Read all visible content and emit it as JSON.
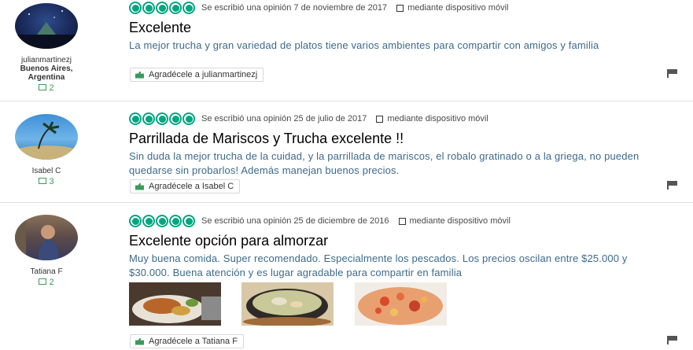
{
  "reviews": [
    {
      "username": "julianmartinezj",
      "location": "Buenos Aires, Argentina",
      "review_count": "2",
      "review_count_icon": "review-count-icon",
      "bubbles": 5,
      "date_text": "Se escribió una opinión 7 de noviembre de 2017",
      "mobile_text": "mediante dispositivo móvil",
      "title": "Excelente",
      "text": "La mejor trucha y gran variedad de platos tiene varios ambientes para compartir con amigos y familia",
      "thank_label": "Agradécele a julianmartinezj"
    },
    {
      "username": "Isabel C",
      "location": "",
      "review_count": "3",
      "review_count_icon": "review-count-icon",
      "bubbles": 5,
      "date_text": "Se escribió una opinión 25 de julio de 2017",
      "mobile_text": "mediante dispositivo móvil",
      "title": "Parrillada de Mariscos y Trucha excelente !!",
      "text": "Sin duda la mejor trucha de la cuidad, y la parrillada de mariscos, el robalo gratinado o a la griega, no pueden quedarse sin probarlos! Además manejan buenos precios.",
      "thank_label": "Agradécele a Isabel C"
    },
    {
      "username": "Tatiana F",
      "location": "",
      "review_count": "2",
      "review_count_icon": "review-count-icon",
      "bubbles": 5,
      "date_text": "Se escribió una opinión 25 de diciembre de 2016",
      "mobile_text": "mediante dispositivo móvil",
      "title": "Excelente opción para almorzar",
      "text": "Muy buena comida. Super recomendado. Especialmente los pescados. Los precios oscilan entre $25.000 y $30.000. Buena atención y es lugar agradable para compartir en familia",
      "thank_label": "Agradécele a Tatiana F"
    }
  ],
  "colors": {
    "bubble": "#00a680",
    "text_blue": "#3d6a8a",
    "count_green": "#3a9a5b"
  }
}
